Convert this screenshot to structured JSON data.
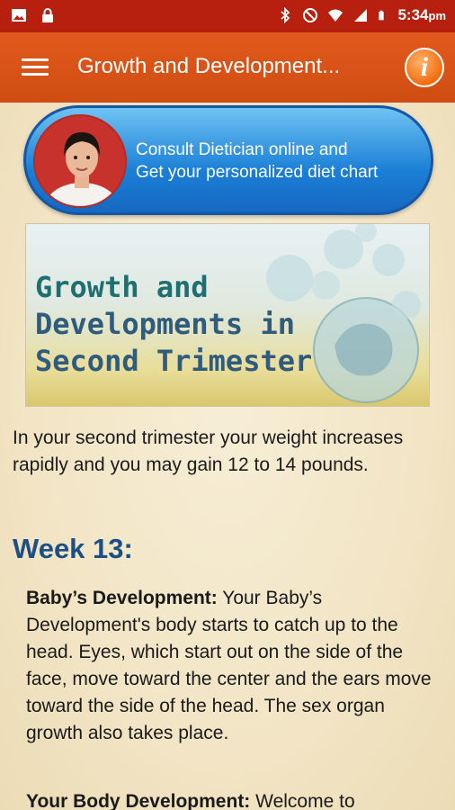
{
  "status_bar": {
    "time": "5:34",
    "ampm": "pm",
    "icons": [
      "image-icon",
      "lock-icon",
      "bluetooth-icon",
      "do-not-disturb-icon",
      "wifi-icon",
      "signal-icon",
      "battery-icon"
    ]
  },
  "app_bar": {
    "title": "Growth and Development...",
    "menu_icon": "hamburger-menu-icon",
    "info_label": "i"
  },
  "consult_banner": {
    "line1": "Consult Dietician online and",
    "line2": "Get your personalized diet chart"
  },
  "hero": {
    "line1": "Growth and",
    "line2": "Developments in",
    "line3": "Second Trimester"
  },
  "intro": "In your second trimester your weight increases rapidly and you may gain 12 to 14 pounds.",
  "week": {
    "heading": "Week 13:"
  },
  "sections": [
    {
      "label": "Baby’s Development:",
      "text": " Your Baby’s Development's body starts to catch up to the head. Eyes, which start out on the side of the face, move toward the center and the ears move toward the side of the head. The sex organ growth also takes place."
    },
    {
      "label": "Your Body Development:",
      "text": " Welcome to"
    }
  ],
  "colors": {
    "status_bar": "#b71f0e",
    "app_bar": "#d9531a",
    "banner_blue": "#1b7fd6",
    "week_heading": "#1c4f86",
    "background": "#f3e7c9"
  }
}
